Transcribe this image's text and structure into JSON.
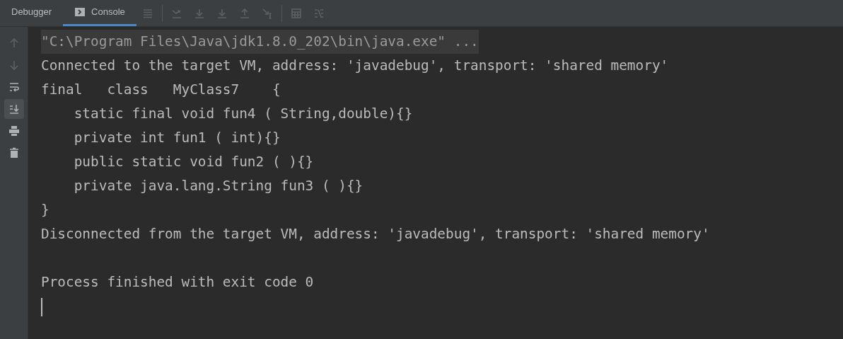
{
  "tabs": [
    {
      "label": "Debugger",
      "selected": false,
      "kind": "plain"
    },
    {
      "label": "Console",
      "selected": true,
      "kind": "console"
    }
  ],
  "toolbar": [
    {
      "kind": "menu",
      "disabled": true
    },
    {
      "kind": "step-over",
      "disabled": true
    },
    {
      "kind": "step-into",
      "disabled": true
    },
    {
      "kind": "force-step-into",
      "disabled": true
    },
    {
      "kind": "step-out",
      "disabled": true
    },
    {
      "kind": "run-to-cursor",
      "disabled": true
    },
    {
      "kind": "evaluate",
      "disabled": true
    },
    {
      "kind": "trace",
      "disabled": true
    }
  ],
  "sidebar": [
    {
      "kind": "up",
      "disabled": true,
      "on": false
    },
    {
      "kind": "down",
      "disabled": true,
      "on": false
    },
    {
      "kind": "wrap",
      "disabled": false,
      "on": false
    },
    {
      "kind": "scroll-end",
      "disabled": false,
      "on": true
    },
    {
      "kind": "print",
      "disabled": false,
      "on": false
    },
    {
      "kind": "trash",
      "disabled": false,
      "on": false
    }
  ],
  "console": [
    {
      "kind": "command",
      "text": "\"C:\\Program Files\\Java\\jdk1.8.0_202\\bin\\java.exe\" ..."
    },
    {
      "kind": "output",
      "text": "Connected to the target VM, address: 'javadebug', transport: 'shared memory'"
    },
    {
      "kind": "output",
      "text": "final   class   MyClass7    {"
    },
    {
      "kind": "output",
      "text": "    static final void fun4 ( String,double){}"
    },
    {
      "kind": "output",
      "text": "    private int fun1 ( int){}"
    },
    {
      "kind": "output",
      "text": "    public static void fun2 ( ){}"
    },
    {
      "kind": "output",
      "text": "    private java.lang.String fun3 ( ){}"
    },
    {
      "kind": "output",
      "text": "}"
    },
    {
      "kind": "output",
      "text": "Disconnected from the target VM, address: 'javadebug', transport: 'shared memory'"
    },
    {
      "kind": "blank"
    },
    {
      "kind": "output",
      "text": "Process finished with exit code 0"
    },
    {
      "kind": "cursor"
    }
  ]
}
